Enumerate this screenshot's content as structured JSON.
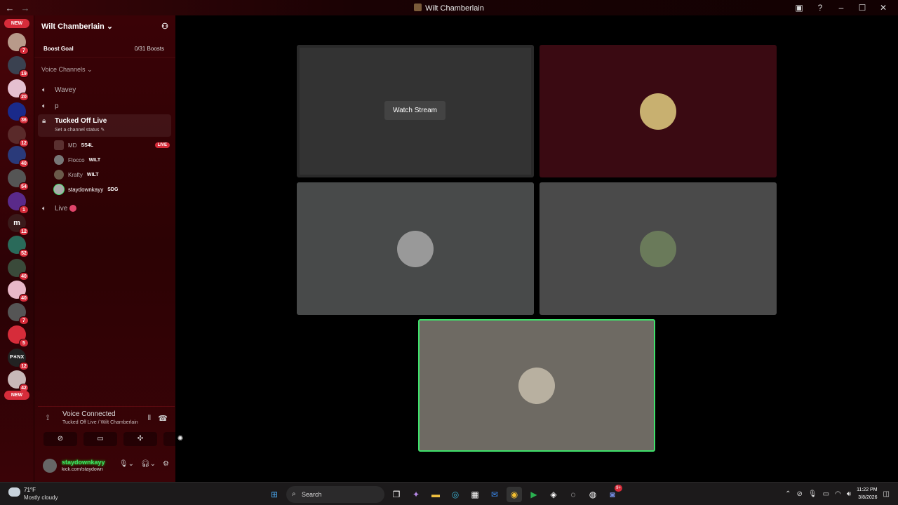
{
  "window": {
    "title": "Wilt Chamberlain"
  },
  "server": {
    "name": "Wilt Chamberlain",
    "boost_label": "Boost Goal",
    "boost_count": "0/31 Boosts"
  },
  "servers": [
    {
      "badge": "7"
    },
    {
      "badge": "19"
    },
    {
      "badge": "20"
    },
    {
      "badge": "36"
    },
    {
      "badge": "12"
    },
    {
      "badge": "40"
    },
    {
      "badge": "54"
    },
    {
      "badge": "1"
    },
    {
      "badge": "12"
    },
    {
      "badge": "52"
    },
    {
      "badge": "40"
    },
    {
      "badge": "40"
    },
    {
      "badge": "7"
    },
    {
      "badge": "5"
    },
    {
      "badge": "12"
    },
    {
      "badge": "42"
    }
  ],
  "new_label": "NEW",
  "category": "Voice Channels",
  "channels": {
    "wavey": "Wavey",
    "p": "p",
    "active_name": "Tucked Off Live",
    "active_status": "Set a channel status",
    "live": "Live"
  },
  "voice_users": [
    {
      "name": "MD",
      "tag": "SS4L",
      "live": "LIVE"
    },
    {
      "name": "Flocco",
      "tag": "WILT"
    },
    {
      "name": "Krafty",
      "tag": "WILT"
    },
    {
      "name": "staydownkayy",
      "tag": "SDG"
    }
  ],
  "voice_panel": {
    "status": "Voice Connected",
    "location": "Tucked Off Live / Wilt Chamberlain"
  },
  "user_panel": {
    "name": "staydownkayy",
    "status": "kick.com/staydown"
  },
  "stage": {
    "watch_label": "Watch Stream"
  },
  "taskbar": {
    "temp": "71°F",
    "weather": "Mostly cloudy",
    "search": "Search",
    "time": "11:22 PM",
    "date": "3/8/2026",
    "notif": "9+"
  },
  "colors": {
    "accent": "#d62c3a",
    "speaking": "#3ee26a"
  }
}
